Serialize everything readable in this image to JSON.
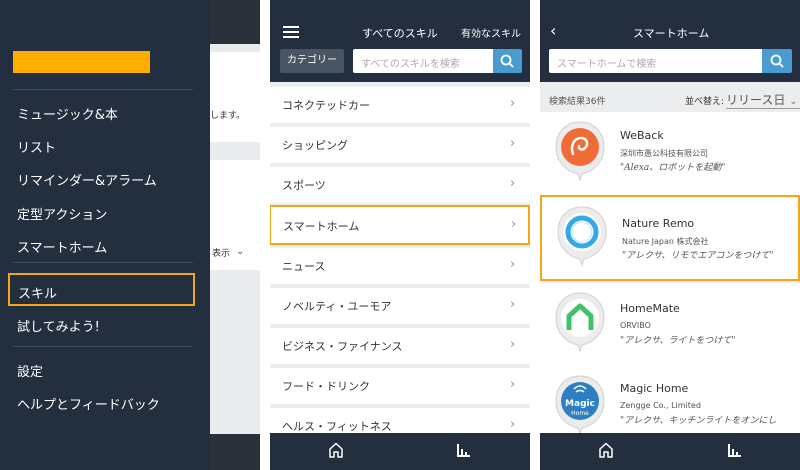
{
  "panel1": {
    "background_snippet": "します。",
    "background_label": "表示",
    "menu": [
      {
        "label": "ミュージック&本"
      },
      {
        "label": "リスト"
      },
      {
        "label": "リマインダー&アラーム"
      },
      {
        "label": "定型アクション"
      },
      {
        "label": "スマートホーム"
      },
      {
        "label": "スキル",
        "selected": true
      },
      {
        "label": "試してみよう!"
      },
      {
        "label": "設定"
      },
      {
        "label": "ヘルプとフィードバック"
      }
    ],
    "colors": {
      "drawer": "#232f3e",
      "logo": "#ffad00",
      "highlight": "#f6a41c"
    }
  },
  "panel2": {
    "header": {
      "title": "すべてのスキル",
      "enabled_skills": "有効なスキル"
    },
    "category_button": "カテゴリー",
    "search": {
      "placeholder": "すべてのスキルを検索"
    },
    "categories": [
      {
        "label": "コネクテッドカー"
      },
      {
        "label": "ショッピング"
      },
      {
        "label": "スポーツ"
      },
      {
        "label": "スマートホーム",
        "selected": true
      },
      {
        "label": "ニュース"
      },
      {
        "label": "ノベルティ・ユーモア"
      },
      {
        "label": "ビジネス・ファイナンス"
      },
      {
        "label": "フード・ドリンク"
      },
      {
        "label": "ヘルス・フィットネス"
      }
    ],
    "tabbar": {
      "icons": [
        "home-icon",
        "activity-icon"
      ]
    }
  },
  "panel3": {
    "header": {
      "title": "スマートホーム"
    },
    "search": {
      "placeholder": "スマートホームで検索"
    },
    "result_count": "検索結果36件",
    "sort": {
      "label": "並べ替え:",
      "value": "リリース日"
    },
    "results": [
      {
        "name": "WeBack",
        "developer": "深圳市愚公科技有限公司",
        "phrase": "\"Alexa、ロボットを起動\"",
        "icon_color": "#ef6c39"
      },
      {
        "name": "Nature Remo",
        "developer": "Nature Japan 株式会社",
        "phrase": "\"アレクサ、リモでエアコンをつけて\"",
        "selected": true,
        "icon_color": "#34a8e8"
      },
      {
        "name": "HomeMate",
        "developer": "ORVIBO",
        "phrase": "\"アレクサ、ライトをつけて\"",
        "icon_color": "#3fc26b"
      },
      {
        "name": "Magic Home",
        "developer": "Zengge Co., Limited",
        "phrase": "\"アレクサ、キッチンライトをオンにし",
        "icon_color": "#2d7fc2",
        "icon_text": "Magic",
        "icon_subtext": "Home"
      }
    ],
    "tabbar": {
      "icons": [
        "home-icon",
        "activity-icon"
      ]
    }
  }
}
